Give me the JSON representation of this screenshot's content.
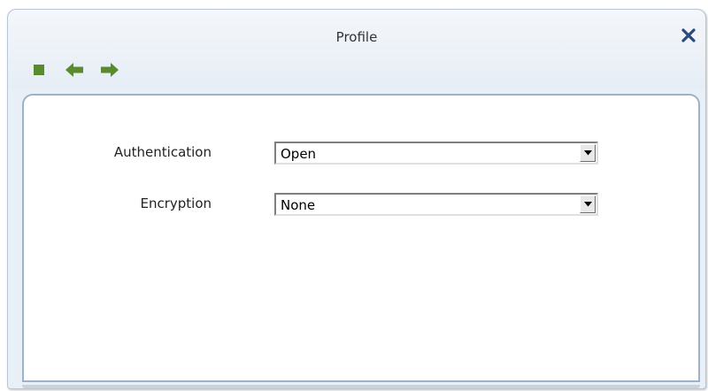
{
  "window": {
    "title": "Profile"
  },
  "toolbar": {
    "buttons": [
      {
        "name": "stop",
        "icon": "stop-square-icon"
      },
      {
        "name": "back",
        "icon": "arrow-left-icon"
      },
      {
        "name": "forward",
        "icon": "arrow-right-icon"
      }
    ],
    "icon_color": "#5a8a2e"
  },
  "form": {
    "authentication": {
      "label": "Authentication",
      "value": "Open"
    },
    "encryption": {
      "label": "Encryption",
      "value": "None"
    }
  },
  "colors": {
    "window_bg": "#e9eff6",
    "panel_border": "#9fb1c6",
    "close_icon": "#2b4a7a"
  }
}
